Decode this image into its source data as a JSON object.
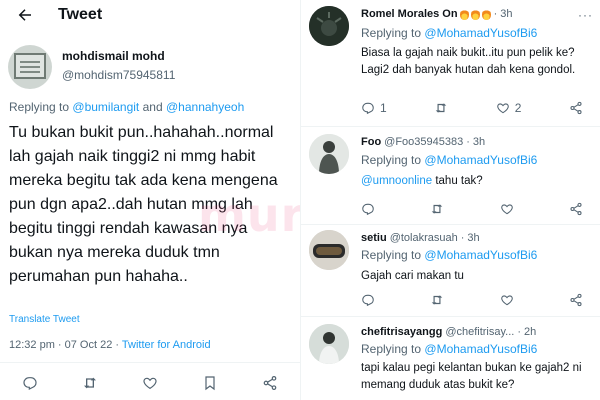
{
  "header": {
    "title": "Tweet"
  },
  "main_tweet": {
    "author_name": "mohdismail mohd",
    "author_handle": "@mohdism75945811",
    "replying_prefix": "Replying to",
    "mention_1": "@bumilangit",
    "and_word": "and",
    "mention_2": "@hannahyeoh",
    "text": "Tu bukan bukit pun..hahahah..normal lah gajah naik tinggi2 ni mmg habit mereka begitu tak ada kena mengena pun dgn apa2..dah hutan mmg lah begitu tinggi rendah kawasan nya bukan nya mereka duduk tmn perumahan pun hahaha..",
    "translate": "Translate Tweet",
    "timestamp": "12:32 pm · 07 Oct 22 · ",
    "client": "Twitter for Android"
  },
  "watermark": "murai",
  "replies": [
    {
      "name": "Romel Morales On",
      "handle": "",
      "time": "3h",
      "replying_prefix": "Replying to",
      "replying_to": "@MohamadYusofBi6",
      "text": "Biasa la gajah naik bukit..itu pun pelik ke? Lagi2 dah banyak hutan dah kena gondol.",
      "counts": {
        "reply": "1",
        "retweet": "",
        "like": "2"
      }
    },
    {
      "name": "Foo",
      "handle": "@Foo35945383",
      "time": "3h",
      "replying_prefix": "Replying to",
      "replying_to": "@MohamadYusofBi6",
      "mention": "@umnoonline",
      "text": " tahu tak?",
      "counts": {
        "reply": "",
        "retweet": "",
        "like": ""
      }
    },
    {
      "name": "setiu",
      "handle": "@tolakrasuah",
      "time": "3h",
      "replying_prefix": "Replying to",
      "replying_to": "@MohamadYusofBi6",
      "text": "Gajah cari makan tu",
      "counts": {
        "reply": "",
        "retweet": "",
        "like": ""
      }
    },
    {
      "name": "chefitrisayangg",
      "handle": "@chefitrisay...",
      "time": "2h",
      "replying_prefix": "Replying to",
      "replying_to": "@MohamadYusofBi6",
      "text": "tapi kalau pegi kelantan bukan ke gajah2 ni memang duduk atas bukit ke?",
      "counts": {
        "reply": "",
        "retweet": "",
        "like": ""
      }
    }
  ],
  "more_menu": "···",
  "dot": "·",
  "icons": [
    "back-arrow-icon",
    "reply-icon",
    "retweet-icon",
    "like-icon",
    "bookmark-icon",
    "share-icon",
    "more-icon",
    "flame-icon"
  ],
  "colors": {
    "link": "#1d9bf0",
    "muted": "#536471",
    "text": "#0f1419"
  }
}
